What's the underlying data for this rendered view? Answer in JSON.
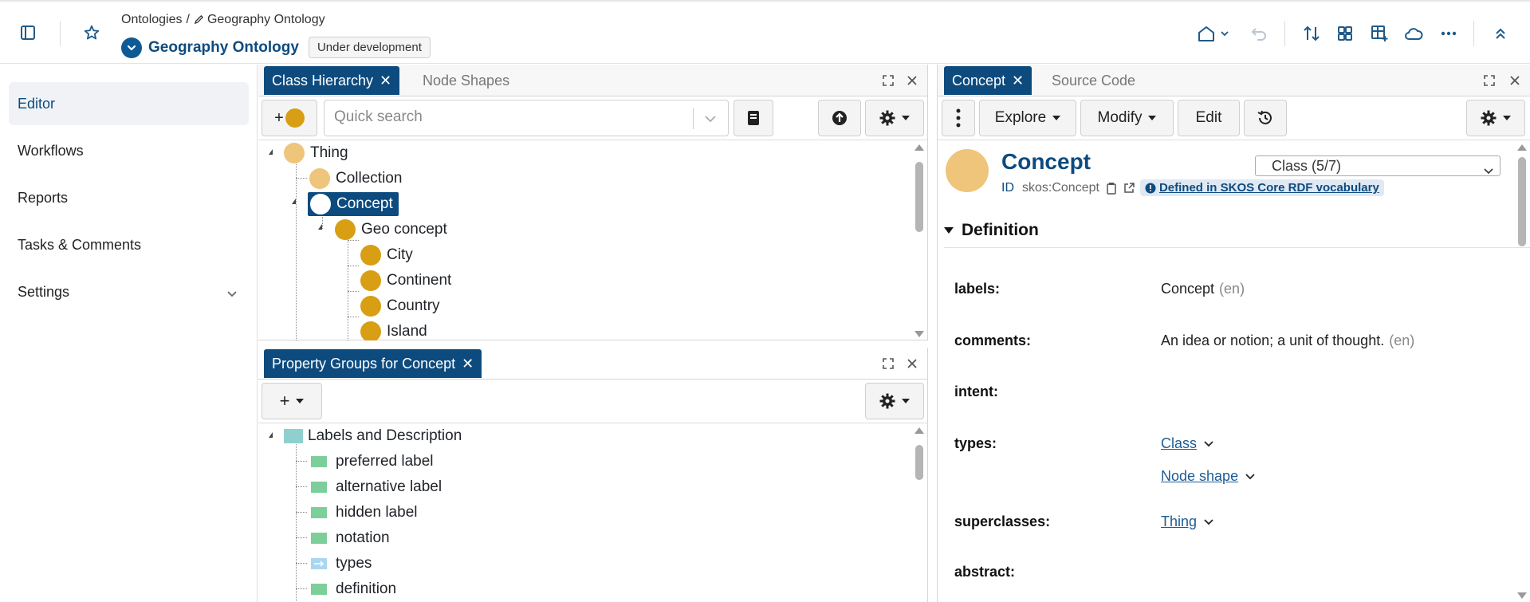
{
  "header": {
    "breadcrumb_root": "Ontologies",
    "breadcrumb_sep": "/",
    "breadcrumb_current": "Geography Ontology",
    "project_title": "Geography Ontology",
    "status_badge": "Under development"
  },
  "sidebar": {
    "items": [
      {
        "label": "Editor",
        "active": true
      },
      {
        "label": "Workflows"
      },
      {
        "label": "Reports"
      },
      {
        "label": "Tasks & Comments"
      },
      {
        "label": "Settings"
      }
    ]
  },
  "class_panel": {
    "tabs": [
      "Class Hierarchy",
      "Node Shapes"
    ],
    "add_label": "+",
    "search_placeholder": "Quick search",
    "tree": [
      {
        "label": "Thing",
        "color": "#efc47b"
      },
      {
        "label": "Collection",
        "color": "#efc47b"
      },
      {
        "label": "Concept",
        "selected": true
      },
      {
        "label": "Geo concept",
        "color": "#d89e14"
      },
      {
        "label": "City",
        "color": "#d89e14"
      },
      {
        "label": "Continent",
        "color": "#d89e14"
      },
      {
        "label": "Country",
        "color": "#d89e14"
      },
      {
        "label": "Island",
        "color": "#d89e14"
      }
    ]
  },
  "property_panel": {
    "tab": "Property Groups for Concept",
    "add_label": "+",
    "tree": [
      {
        "label": "Labels and Description",
        "kind": "group"
      },
      {
        "label": "preferred label",
        "kind": "datatype"
      },
      {
        "label": "alternative label",
        "kind": "datatype"
      },
      {
        "label": "hidden label",
        "kind": "datatype"
      },
      {
        "label": "notation",
        "kind": "datatype"
      },
      {
        "label": "types",
        "kind": "object"
      },
      {
        "label": "definition",
        "kind": "datatype"
      }
    ]
  },
  "form_panel": {
    "tabs": [
      "Concept",
      "Source Code"
    ],
    "toolbar": {
      "explore": "Explore",
      "modify": "Modify",
      "edit": "Edit"
    },
    "title": "Concept",
    "class_select": "Class (5/7)",
    "id_label": "ID",
    "id_value": "skos:Concept",
    "defined_in": "Defined in SKOS Core RDF vocabulary",
    "section": "Definition",
    "fields": {
      "labels": {
        "label": "labels:",
        "value": "Concept",
        "lang": "(en)"
      },
      "comments": {
        "label": "comments:",
        "value": "An idea or notion; a unit of thought.",
        "lang": "(en)"
      },
      "intent": {
        "label": "intent:"
      },
      "types": {
        "label": "types:",
        "values": [
          "Class",
          "Node shape"
        ]
      },
      "superclasses": {
        "label": "superclasses:",
        "value": "Thing"
      },
      "abstract": {
        "label": "abstract:"
      }
    }
  },
  "colors": {
    "brand": "#0d4b7f",
    "class_light": "#efc47b",
    "class_dark": "#d89e14",
    "datatype_prop": "#7ccf9a",
    "object_prop": "#a9d7f3"
  }
}
